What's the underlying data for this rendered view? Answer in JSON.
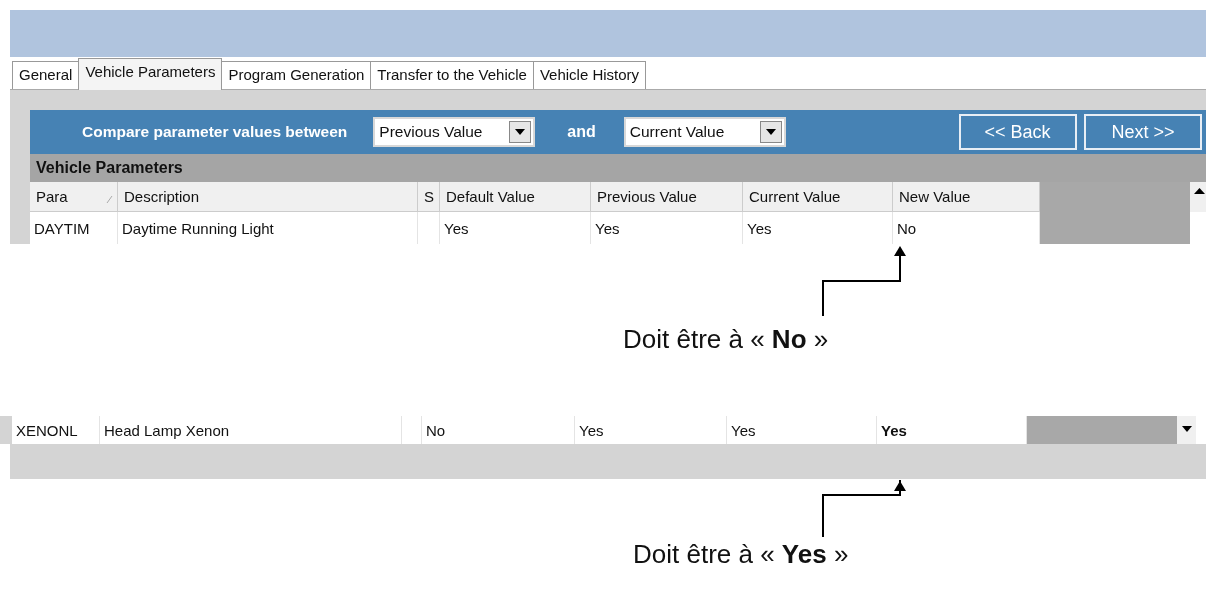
{
  "tabs": [
    {
      "label": "General",
      "selected": false
    },
    {
      "label": "Vehicle Parameters",
      "selected": true
    },
    {
      "label": "Program Generation",
      "selected": false
    },
    {
      "label": "Transfer to the Vehicle",
      "selected": false
    },
    {
      "label": "Vehicle History",
      "selected": false
    }
  ],
  "compare": {
    "label": "Compare parameter values between",
    "first": "Previous Value",
    "joiner": "and",
    "second": "Current Value"
  },
  "buttons": [
    "<< Back",
    "Next >>"
  ],
  "section_title": "Vehicle Parameters",
  "table": {
    "columns": [
      "Para",
      "Description",
      "S",
      "Default Value",
      "Previous Value",
      "Current Value",
      "New Value"
    ],
    "rows": [
      {
        "cells": [
          "DAYTIM",
          "Daytime Running Light",
          "",
          "Yes",
          "Yes",
          "Yes",
          "No"
        ],
        "new_bold": false
      }
    ]
  },
  "annotation_1": "Doit être à « **No** »",
  "second_row": {
    "cells": [
      "XENONL",
      "Head Lamp Xenon",
      "",
      "No",
      "Yes",
      "Yes",
      "Yes"
    ],
    "new_bold": true
  },
  "annotation_2": "Doit être à « **Yes** »"
}
